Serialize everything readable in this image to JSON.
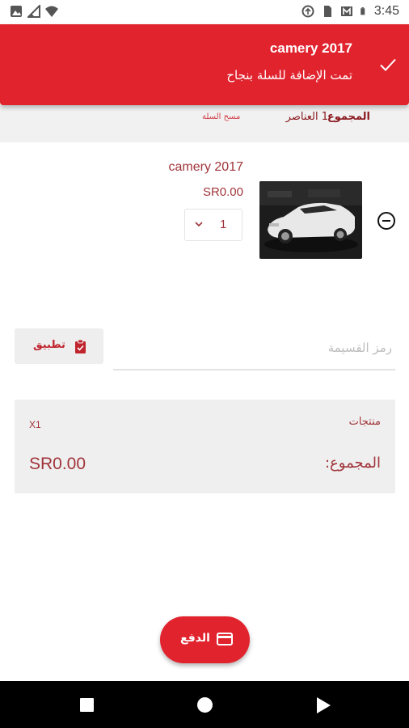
{
  "status_bar": {
    "time": "3:45",
    "left_icons": [
      "image-icon",
      "signal-icon",
      "wifi-icon"
    ],
    "right_icons": [
      "data-saver-icon",
      "sim-icon",
      "gallery-icon",
      "battery-icon"
    ]
  },
  "toast": {
    "title": "camery 2017",
    "message": "تمت الإضافة للسلة بنجاح",
    "icon": "check-icon",
    "color": "#e1232e"
  },
  "cart_header": {
    "total_label": "المجموع",
    "items_count": "1 العناصر",
    "clear_cart": "مسح السلة"
  },
  "cart_items": [
    {
      "title": "camery 2017",
      "price": "SR0.00",
      "quantity": "1"
    }
  ],
  "coupon": {
    "placeholder": "رمز القسيمة",
    "apply_label": "تطبيق"
  },
  "summary": {
    "products_label": "منتجات",
    "products_qty": "X1",
    "total_label": "المجموع:",
    "total_value": "SR0.00"
  },
  "checkout": {
    "label": "الدفع",
    "icon": "credit-card-icon"
  },
  "colors": {
    "accent": "#e1232e",
    "text_accent": "#a0343a",
    "panel": "#efefef"
  }
}
